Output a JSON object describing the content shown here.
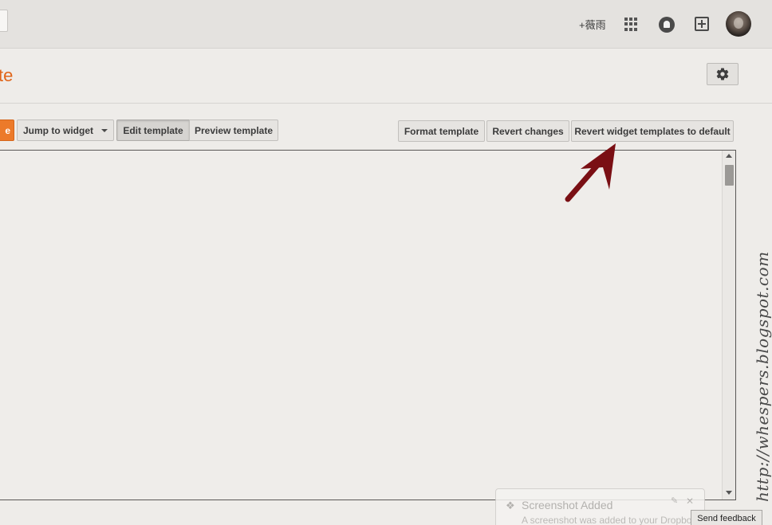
{
  "topbar": {
    "plus_name": "+薇雨",
    "apps_icon": "apps-grid-icon",
    "notifications_icon": "bell-icon",
    "share_icon": "add-box-icon",
    "avatar": "user-avatar"
  },
  "header": {
    "title_fragment": "te",
    "settings_icon": "gear-icon",
    "title_color": "#e0651a"
  },
  "toolbar": {
    "orange_button_fragment": "e",
    "jump_to_widget": "Jump to widget",
    "edit_template": "Edit template",
    "preview_template": "Preview template",
    "format_template": "Format template",
    "revert_changes": "Revert changes",
    "revert_widget_templates": "Revert widget templates to default"
  },
  "watermark": "http://whespers.blogspot.com",
  "toast": {
    "icon": "dropbox-icon",
    "title": "Screenshot Added",
    "body": "A screenshot was added to your Dropbox."
  },
  "send_feedback": "Send feedback",
  "colors": {
    "accent_orange": "#ec7a2a",
    "arrow_red": "#7a0f14"
  }
}
